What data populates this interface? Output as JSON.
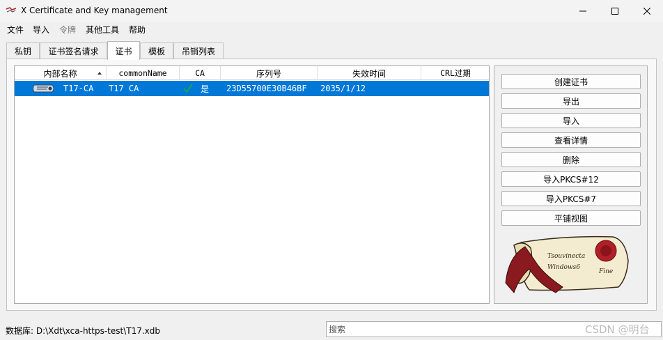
{
  "window": {
    "title": "X Certificate and Key management"
  },
  "menu": [
    {
      "label": "文件"
    },
    {
      "label": "导入"
    },
    {
      "label": "令牌"
    },
    {
      "label": "其他工具"
    },
    {
      "label": "帮助"
    }
  ],
  "tabs": [
    {
      "label": "私钥"
    },
    {
      "label": "证书签名请求"
    },
    {
      "label": "证书",
      "active": true
    },
    {
      "label": "模板"
    },
    {
      "label": "吊销列表"
    }
  ],
  "table": {
    "columns": [
      "内部名称",
      "commonName",
      "CA",
      "序列号",
      "失效时间",
      "CRL过期"
    ],
    "rows": [
      {
        "internal_name": "T17-CA",
        "common_name": "T17 CA",
        "ca": "是",
        "serial": "23D55700E30B46BF",
        "expiry": "2035/1/12",
        "crl_expiry": ""
      }
    ]
  },
  "buttons": [
    {
      "label": "创建证书"
    },
    {
      "label": "导出"
    },
    {
      "label": "导入"
    },
    {
      "label": "查看详情"
    },
    {
      "label": "删除"
    },
    {
      "label": "导入PKCS#12"
    },
    {
      "label": "导入PKCS#7"
    },
    {
      "label": "平铺视图"
    }
  ],
  "scroll_image": {
    "text_line1": "Tsouvinecta",
    "text_line2": "Windows6",
    "text_line3": "Fine"
  },
  "status": {
    "database_label": "数据库: D:\\Xdt\\xca-https-test\\T17.xdb"
  },
  "search": {
    "placeholder": "搜索"
  },
  "watermark": "CSDN @明台",
  "colors": {
    "selection": "#0078d7",
    "check": "#1fa34a",
    "seal": "#b02028"
  }
}
